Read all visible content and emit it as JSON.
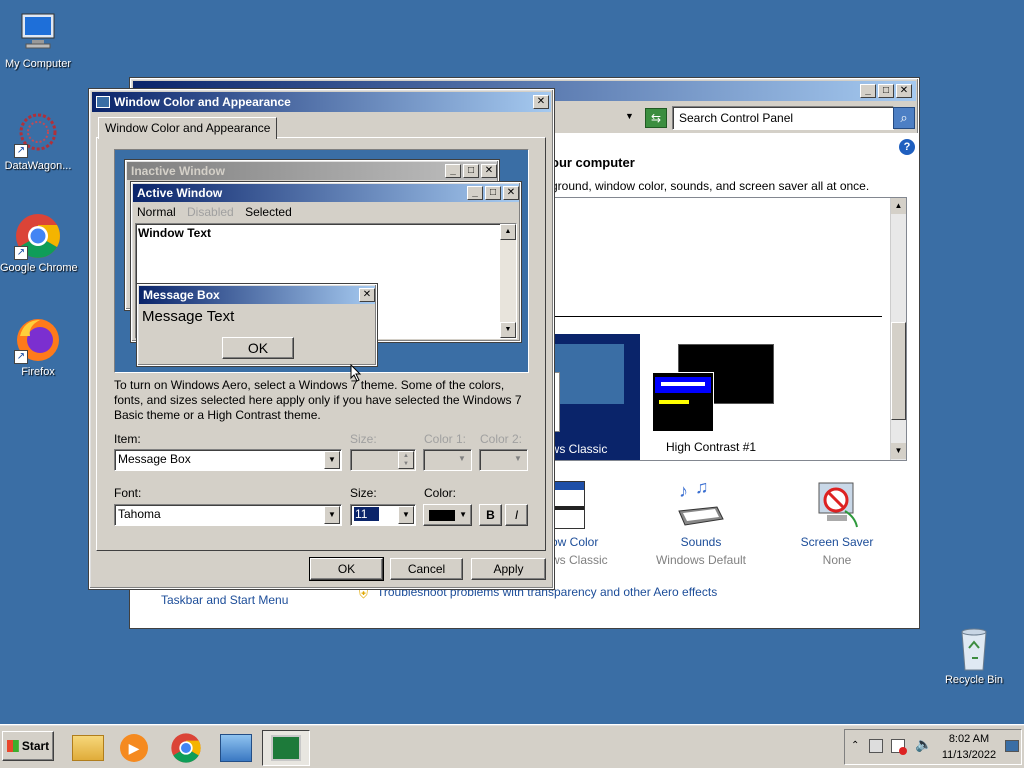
{
  "desktop": {
    "icons": [
      {
        "label": "My Computer"
      },
      {
        "label": "DataWagon..."
      },
      {
        "label": "Google Chrome"
      },
      {
        "label": "Firefox"
      },
      {
        "label": "Recycle Bin"
      }
    ]
  },
  "bg_window": {
    "search_placeholder": "Search Control Panel",
    "heading_partial": "our computer",
    "desc_partial": "ground, window color, sounds, and screen saver all at once.",
    "themes": [
      {
        "label": "ows Classic"
      },
      {
        "label": "High Contrast #1"
      }
    ],
    "tiles": [
      {
        "label": "ow Color",
        "sub": "ws Classic"
      },
      {
        "label": "Sounds",
        "sub": "Windows Default"
      },
      {
        "label": "Screen Saver",
        "sub": "None"
      }
    ],
    "link_taskbar": "Taskbar and Start Menu",
    "link_troubleshoot": "Troubleshoot problems with transparency and other Aero effects"
  },
  "dialog": {
    "title": "Window Color and Appearance",
    "tab_label": "Window Color and Appearance",
    "preview": {
      "inactive_title": "Inactive Window",
      "active_title": "Active Window",
      "menu_normal": "Normal",
      "menu_disabled": "Disabled",
      "menu_selected": "Selected",
      "window_text": "Window Text",
      "msgbox_title": "Message Box",
      "msgbox_text": "Message Text",
      "msgbox_ok": "OK"
    },
    "info_text": "To turn on Windows Aero, select a Windows 7 theme.  Some of the colors, fonts, and sizes selected here apply only if you have selected the Windows 7 Basic theme or a High Contrast theme.",
    "item_label": "Item:",
    "item_value": "Message Box",
    "size_label": "Size:",
    "color1_label": "Color 1:",
    "color2_label": "Color 2:",
    "font_label": "Font:",
    "font_value": "Tahoma",
    "font_size_label": "Size:",
    "font_size_value": "11",
    "font_color_label": "Color:",
    "bold_label": "B",
    "italic_label": "I",
    "ok_label": "OK",
    "cancel_label": "Cancel",
    "apply_label": "Apply"
  },
  "taskbar": {
    "start_label": "Start",
    "time": "8:02 AM",
    "date": "11/13/2022"
  },
  "colors": {
    "desktop": "#3a6ea5",
    "active_title_start": "#0a246a",
    "active_title_end": "#a6caf0",
    "inactive_title": "#808080",
    "selection": "#0a246a"
  }
}
